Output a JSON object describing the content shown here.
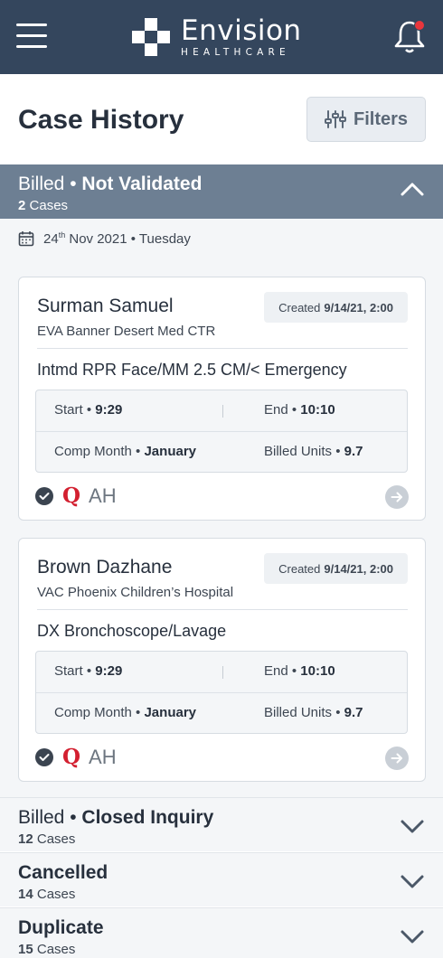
{
  "header": {
    "brand_name": "Envision",
    "brand_sub": "HEALTHCARE",
    "notification_dot_color": "#e8363c",
    "menu_icon": "hamburger-menu-icon",
    "bell_icon": "bell-icon"
  },
  "page": {
    "title": "Case History",
    "filters_label": "Filters"
  },
  "sections": [
    {
      "status_prefix": "Billed",
      "status": "Not Validated",
      "count": "2",
      "count_label": "Cases",
      "expanded": true
    },
    {
      "status_prefix": "Billed",
      "status": "Closed Inquiry",
      "count": "12",
      "count_label": "Cases",
      "expanded": false
    },
    {
      "status_prefix": "",
      "status": "Cancelled",
      "count": "14",
      "count_label": "Cases",
      "expanded": false
    },
    {
      "status_prefix": "",
      "status": "Duplicate",
      "count": "15",
      "count_label": "Cases",
      "expanded": false
    }
  ],
  "date_group": {
    "day": "24",
    "suffix": "th",
    "rest": "Nov 2021",
    "weekday": "Tuesday"
  },
  "cases": [
    {
      "patient": "Surman Samuel",
      "facility": "EVA Banner Desert Med CTR",
      "created_label": "Created",
      "created_value": "9/14/21, 2:00",
      "procedure": "Intmd RPR Face/MM 2.5 CM/< Emergency",
      "start_label": "Start",
      "start_value": "9:29",
      "end_label": "End",
      "end_value": "10:10",
      "comp_label": "Comp Month",
      "comp_value": "January",
      "units_label": "Billed Units",
      "units_value": "9.7",
      "q_mark": "Q",
      "provider": "AH"
    },
    {
      "patient": "Brown Dazhane",
      "facility": "VAC Phoenix Children’s Hospital",
      "created_label": "Created",
      "created_value": "9/14/21, 2:00",
      "procedure": "DX Bronchoscope/Lavage",
      "start_label": "Start",
      "start_value": "9:29",
      "end_label": "End",
      "end_value": "10:10",
      "comp_label": "Comp Month",
      "comp_value": "January",
      "units_label": "Billed Units",
      "units_value": "9.7",
      "q_mark": "Q",
      "provider": "AH"
    }
  ]
}
